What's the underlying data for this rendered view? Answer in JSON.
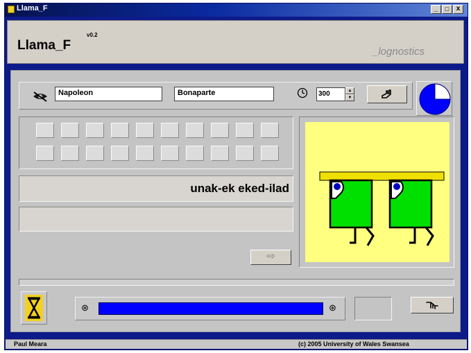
{
  "window": {
    "title": "Llama_F"
  },
  "titlebar_buttons": {
    "minimize": "_",
    "maximize": "□",
    "close": "x"
  },
  "header": {
    "app_name": "Llama_F",
    "version": "v0.2",
    "brand": "_lognostics"
  },
  "participant": {
    "first_name": "Napoleon",
    "last_name": "Bonaparte"
  },
  "timer": {
    "value": "300",
    "pie_fraction_remaining": 0.75
  },
  "word_grid": {
    "rows": 2,
    "cols": 10
  },
  "display": {
    "word": "unak-ek eked-ilad",
    "answer": ""
  },
  "next_label": "⇨",
  "progress": {
    "fraction": 1.0
  },
  "status": {
    "left": "Paul Meara",
    "right": "(c) 2005 University of Wales Swansea"
  },
  "colors": {
    "titlebar": "#0a2aa0",
    "frame": "#0d1a8a",
    "progress_fill": "#0000ff",
    "picture_bg": "#ffff80",
    "creature_body": "#00e000",
    "table_top": "#f0e000"
  }
}
